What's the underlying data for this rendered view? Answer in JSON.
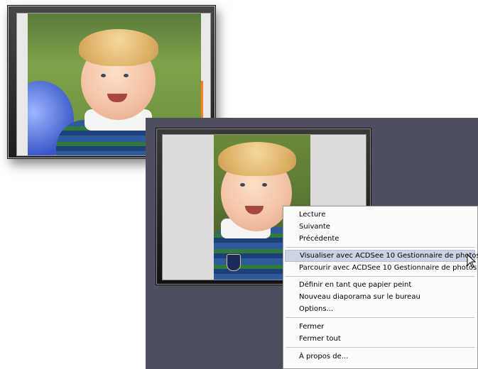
{
  "context_menu": {
    "items": [
      {
        "label": "Lecture"
      },
      {
        "label": "Suivante"
      },
      {
        "label": "Précédente"
      },
      {
        "label": "Visualiser avec ACDSee 10 Gestionnaire de photos",
        "highlighted": true
      },
      {
        "label": "Parcourir avec ACDSee 10 Gestionnaire de photos"
      },
      {
        "label": "Définir en tant que papier peint"
      },
      {
        "label": "Nouveau diaporama sur le bureau"
      },
      {
        "label": "Options..."
      },
      {
        "label": "Fermer"
      },
      {
        "label": "Fermer tout"
      },
      {
        "label": "À propos de..."
      }
    ]
  },
  "colors": {
    "widget_background": "#4d4f60",
    "menu_highlight": "#cdd3e2",
    "accent_bar": "#ff7f1e"
  },
  "icons": [
    "mouse-pointer-icon"
  ]
}
